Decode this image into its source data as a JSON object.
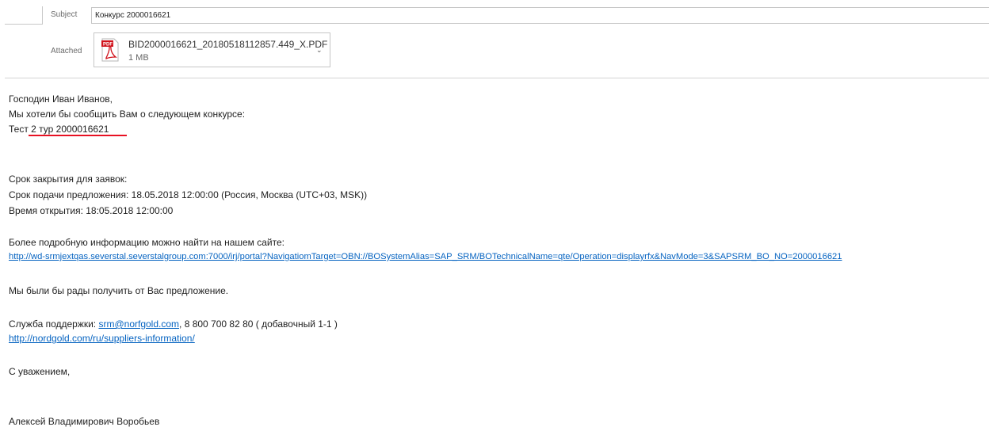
{
  "header": {
    "subject_label": "Subject",
    "subject_value": "Конкурс 2000016621",
    "attached_label": "Attached",
    "attachment": {
      "icon": "pdf-file-icon",
      "icon_badge": "PDF",
      "file_name": "BID2000016621_20180518112857.449_X.PDF",
      "size": "1 MB",
      "menu_glyph": "⌄"
    }
  },
  "body": {
    "greeting": "Господин Иван Иванов,",
    "intro": "Мы хотели бы сообщить Вам о следующем конкурсе:",
    "tender_name": "Тест 2 тур 2000016621",
    "deadline_heading": "Срок закрытия для заявок:",
    "submission_deadline": "Срок подачи предложения: 18.05.2018 12:00:00 (Россия, Москва (UTC+03, MSK))",
    "opening_time": "Время открытия: 18:05.2018 12:00:00",
    "more_info": "Более подробную информацию можно найти на нашем сайте:",
    "portal_link": "http://wd-srmjextqas.severstal.severstalgroup.com:7000/irj/portal?NavigatiomTarget=OBN://BOSystemAlias=SAP_SRM/BOTechnicalName=qte/Operation=displayrfx&NavMode=3&SAPSRM_BO_NO=2000016621",
    "glad": "Мы были бы рады получить от Вас предложение.",
    "support_prefix": "Служба поддержки: ",
    "support_email": "srm@norfgold.com",
    "support_suffix": ", 8 800 700 82 80 ( добавочный 1-1 )",
    "support_link": "http://nordgold.com/ru/suppliers-information/",
    "regards": "С уважением,",
    "signature": "Алексей Владимирович Воробьев"
  },
  "colors": {
    "link": "#0563c1",
    "highlight_underline": "#e81123",
    "pdf_red": "#d0121b"
  }
}
